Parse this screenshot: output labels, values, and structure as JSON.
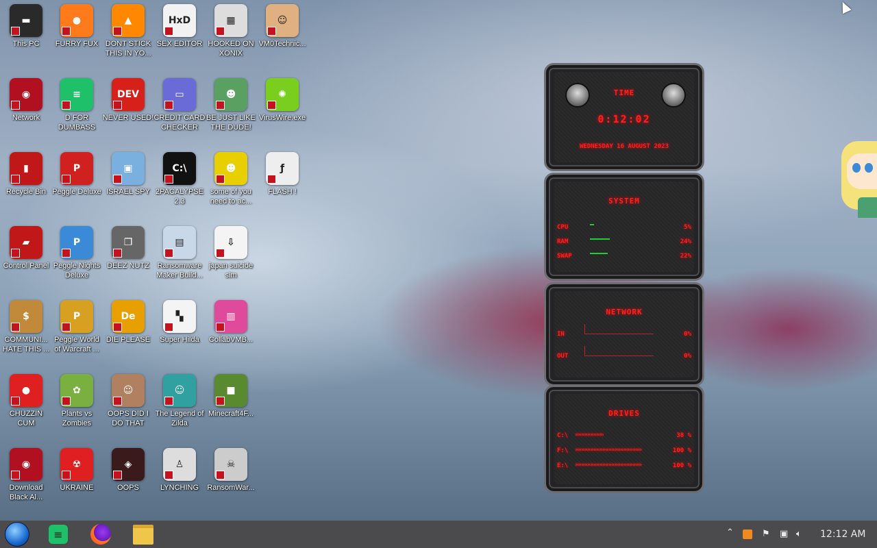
{
  "desktop": {
    "icons": [
      {
        "label": "This PC",
        "icon": "computer-icon",
        "color": "#2a2a2a",
        "glyph": "▬"
      },
      {
        "label": "FURRY FUX",
        "icon": "firefox-icon",
        "color": "#ff7a1a",
        "glyph": "●"
      },
      {
        "label": "DONT STICK THIS IN YO...",
        "icon": "vlc-cone-icon",
        "color": "#ff8800",
        "glyph": "▲"
      },
      {
        "label": "SEX EDITOR",
        "icon": "hex-editor-icon",
        "color": "#f2f2f2",
        "glyph": "HxD"
      },
      {
        "label": "HOOKED ON XONIX",
        "icon": "xonix-game-icon",
        "color": "#dddddd",
        "glyph": "▦"
      },
      {
        "label": "VM0Technic...",
        "icon": "doctor-icon",
        "color": "#e0b080",
        "glyph": "☺"
      },
      {
        "label": "Network",
        "icon": "network-icon",
        "color": "#b01020",
        "glyph": "◉"
      },
      {
        "label": "D FOR DUMBASS",
        "icon": "document-app-icon",
        "color": "#1ec16a",
        "glyph": "≡"
      },
      {
        "label": "NEVER USED!",
        "icon": "devcpp-icon",
        "color": "#d8201a",
        "glyph": "DEV"
      },
      {
        "label": "CREDIT CARD CHECKER",
        "icon": "credit-card-icon",
        "color": "#6b6bd8",
        "glyph": "▭"
      },
      {
        "label": "BE JUST LIKE THE DUDE!",
        "icon": "santa-icon",
        "color": "#5aa060",
        "glyph": "☻"
      },
      {
        "label": "VirusWire.exe",
        "icon": "lime-icon",
        "color": "#7acf1e",
        "glyph": "✺"
      },
      {
        "label": "Recycle Bin",
        "icon": "recycle-bin-icon",
        "color": "#c01818",
        "glyph": "▮"
      },
      {
        "label": "Peggle Deluxe",
        "icon": "peggle-icon",
        "color": "#d02020",
        "glyph": "P"
      },
      {
        "label": "ISRAEL SPY",
        "icon": "network-share-icon",
        "color": "#7ab0e0",
        "glyph": "▣"
      },
      {
        "label": "2PACALYPSE 2.3",
        "icon": "terminal-icon",
        "color": "#111111",
        "glyph": "C:\\"
      },
      {
        "label": "some of you need to ac...",
        "icon": "beaver-icon",
        "color": "#e8d000",
        "glyph": "☻"
      },
      {
        "label": "FLASH !",
        "icon": "flash-icon",
        "color": "#eeeeee",
        "glyph": "ƒ"
      },
      {
        "label": "Control Panel",
        "icon": "control-panel-icon",
        "color": "#c01818",
        "glyph": "▰"
      },
      {
        "label": "Peggle Nights Deluxe",
        "icon": "peggle-nights-icon",
        "color": "#3a8ad8",
        "glyph": "P"
      },
      {
        "label": "DEEZ NUTZ",
        "icon": "copies-icon",
        "color": "#666666",
        "glyph": "❐"
      },
      {
        "label": "Ransomware Maker Build...",
        "icon": "window-app-icon",
        "color": "#c8d8e8",
        "glyph": "▤"
      },
      {
        "label": "japan suicide sim",
        "icon": "game-file-icon",
        "color": "#f4f4f4",
        "glyph": "⇩"
      },
      {
        "label": "COMMUNI... HATE THIS ...",
        "icon": "money-bag-icon",
        "color": "#c08a3a",
        "glyph": "$"
      },
      {
        "label": "Peggle World of Warcraft ...",
        "icon": "peggle-wow-icon",
        "color": "#d8a020",
        "glyph": "P"
      },
      {
        "label": "DIE PLEASE",
        "icon": "de-icon",
        "color": "#e8a000",
        "glyph": "De"
      },
      {
        "label": "Super Hilda",
        "icon": "pixel-cat-icon",
        "color": "#f4f4f4",
        "glyph": "▚"
      },
      {
        "label": "CollabVMB...",
        "icon": "monitor-pink-icon",
        "color": "#e04a9a",
        "glyph": "▥"
      },
      {
        "label": "CHUZZIN CUM",
        "icon": "chuzzle-icon",
        "color": "#e02020",
        "glyph": "●"
      },
      {
        "label": "Plants vs Zombies",
        "icon": "pvz-icon",
        "color": "#7ab040",
        "glyph": "✿"
      },
      {
        "label": "OOPS DID I DO THAT",
        "icon": "portrait-icon",
        "color": "#b08060",
        "glyph": "☺"
      },
      {
        "label": "The Legend of Zilda",
        "icon": "pixel-hero-icon",
        "color": "#30a0a0",
        "glyph": "☺"
      },
      {
        "label": "Minecraft4F...",
        "icon": "grass-block-icon",
        "color": "#5a8a30",
        "glyph": "■"
      },
      {
        "label": "Download Black Al...",
        "icon": "alien-orb-icon",
        "color": "#b01020",
        "glyph": "◉"
      },
      {
        "label": "UKRAINE",
        "icon": "radiation-icon",
        "color": "#e02020",
        "glyph": "☢"
      },
      {
        "label": "OOPS",
        "icon": "dark-app-icon",
        "color": "#3a1a1a",
        "glyph": "◈"
      },
      {
        "label": "LYNCHING",
        "icon": "figure-icon",
        "color": "#dddddd",
        "glyph": "♙"
      },
      {
        "label": "RansomWar...",
        "icon": "skull-icon",
        "color": "#cccccc",
        "glyph": "☠"
      }
    ]
  },
  "widget": {
    "time": {
      "title": "TIME",
      "clock": "0:12:02",
      "date": "WEDNESDAY 16 AUGUST 2023"
    },
    "system": {
      "title": "SYSTEM",
      "rows": [
        {
          "label": "CPU",
          "value": "5%",
          "level": 0.05
        },
        {
          "label": "RAM",
          "value": "24%",
          "level": 0.24
        },
        {
          "label": "SWAP",
          "value": "22%",
          "level": 0.22
        }
      ]
    },
    "network": {
      "title": "NETWORK",
      "rows": [
        {
          "label": "IN",
          "value": "0%"
        },
        {
          "label": "OUT",
          "value": "0%"
        }
      ]
    },
    "drives": {
      "title": "DRIVES",
      "rows": [
        {
          "label": "C:\\",
          "value": "38 %",
          "level": 0.38
        },
        {
          "label": "F:\\",
          "value": "100 %",
          "level": 1.0
        },
        {
          "label": "E:\\",
          "value": "100 %",
          "level": 1.0
        }
      ]
    }
  },
  "taskbar": {
    "start_icon": "start-orb-icon",
    "pinned": [
      "docs-app-icon",
      "firefox-icon",
      "file-explorer-icon"
    ],
    "tray_icons": [
      "chevron-up-icon",
      "app-tray-icon",
      "flag-icon",
      "network-tray-icon",
      "volume-icon"
    ],
    "clock": "12:12 AM"
  },
  "colors": {
    "accent_red": "#ff2020",
    "taskbar": "#4b4b4d"
  }
}
